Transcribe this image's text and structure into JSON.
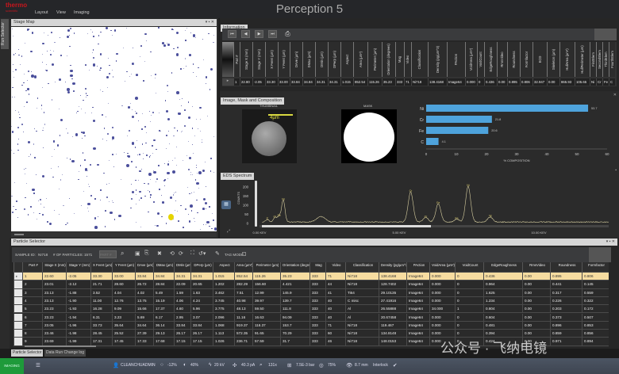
{
  "app": {
    "title": "Perception 5",
    "logo_text": "thermo scientific",
    "menu": [
      "Layout",
      "View",
      "Imaging"
    ],
    "side_tab": "Run Selector"
  },
  "stage_map": {
    "title": "Stage Map",
    "particle_color": "#4b4f9c",
    "selected_color": "#e5d400"
  },
  "information": {
    "title": "Information",
    "toolbar": [
      "first-icon",
      "prev-icon",
      "next-icon",
      "last-icon",
      "print-icon"
    ],
    "headers": [
      "Part #",
      "Stage X (mm)",
      "Stage Y (mm)",
      "X Feret (µm)",
      "Y Feret (µm)",
      "DAve (µm)",
      "DMax (µm)",
      "DMin (µm)",
      "DPerp (µm)",
      "Aspect",
      "Area (µm²)",
      "Perimeter (µm)",
      "Orientation (degrees)",
      "Mag",
      "Video",
      "Classification",
      "Density (pg/µm^3)",
      "PAction",
      "VoidArea (µm²)",
      "VoidCount",
      "EdgeRoughness",
      "RmsVideo",
      "Roundness",
      "Formfactor",
      "ECD",
      "Skeleton (µm)",
      "HullArea (µm²)",
      "HullPerimeter (µm)",
      "FirstElem",
      "SecondElem",
      "ThirdElem",
      "FourthElem"
    ],
    "values": [
      "1",
      "22.80",
      "-2.05",
      "33.30",
      "33.00",
      "33.84",
      "34.84",
      "34.31",
      "34.31",
      "1.015",
      "852.54",
      "115.26",
      "35.23",
      "333",
      "71",
      "Ni718",
      "138.4168",
      "Image64",
      "0.000",
      "0",
      "0.436",
      "0.00",
      "0.895",
      "0.806",
      "32.947",
      "0.00",
      "865.93",
      "105.65",
      "Ni",
      "Cr",
      "Fe",
      "C"
    ]
  },
  "image_mask": {
    "title": "Image, Mask and Composition",
    "thumbnail_label": "THUMBNAIL",
    "mask_label": "MASK",
    "scale_bar": "4µm"
  },
  "eds": {
    "title": "EDS Spectrum"
  },
  "chart_data": [
    {
      "type": "bar",
      "orientation": "horizontal",
      "categories": [
        "Ni",
        "Cr",
        "Fe",
        "C"
      ],
      "values": [
        53.7,
        21.8,
        20.6,
        4.1
      ],
      "data_labels": [
        "53.7",
        "21.8",
        "20.6",
        "4.1"
      ],
      "xlabel": "% COMPOSITION",
      "xlim": [
        0,
        60
      ],
      "xticks": [
        "0",
        "10",
        "20",
        "30",
        "40",
        "50",
        "60"
      ],
      "color": "#4ea3dc"
    },
    {
      "type": "line",
      "ylabel": "COUNTS",
      "ylim": [
        0,
        220
      ],
      "yticks": [
        "0",
        "50",
        "100",
        "150",
        "200"
      ],
      "xlim": [
        0,
        12.5
      ],
      "xticks": [
        {
          "v": 0,
          "label": "0.00 KEV"
        },
        {
          "v": 5,
          "label": "5.00 KEV"
        },
        {
          "v": 10,
          "label": "10.00 KEV"
        }
      ],
      "baseline": 8,
      "color": "#d8cfa0",
      "peaks": [
        {
          "x": 0.28,
          "y": 15,
          "label": "C"
        },
        {
          "x": 0.55,
          "y": 25,
          "label": "Cr"
        },
        {
          "x": 0.7,
          "y": 30,
          "label": "Fe"
        },
        {
          "x": 0.85,
          "y": 120,
          "label": "Ni"
        },
        {
          "x": 2.2,
          "y": 30,
          "label": ""
        },
        {
          "x": 5.41,
          "y": 165,
          "label": "Cr"
        },
        {
          "x": 5.95,
          "y": 25,
          "label": "Cr"
        },
        {
          "x": 6.4,
          "y": 100,
          "label": "Fe"
        },
        {
          "x": 7.06,
          "y": 15,
          "label": "Fe"
        },
        {
          "x": 7.47,
          "y": 195,
          "label": "Ni"
        },
        {
          "x": 8.26,
          "y": 28,
          "label": "Ni"
        }
      ]
    }
  ],
  "particle_selector": {
    "title": "Particle Selector",
    "sample_id_label": "SAMPLE ID:",
    "sample_id": "NI718",
    "particles_label": "# OF PARTICLES:",
    "particles": "1571",
    "part_placeholder": "PART #",
    "tag_mode_label": "TAG MODE:",
    "columns": [
      "Part #",
      "Stage X (mm)",
      "Stage Y (mm)",
      "X Feret (µm)",
      "Y Feret (µm)",
      "DAve (µm)",
      "DMax (µm)",
      "DMin (µm)",
      "DPerp (µm)",
      "Aspect",
      "Area (µm²)",
      "Perimeter (µm)",
      "Orientation (degrees)",
      "Mag",
      "Video",
      "Classification",
      "Density (pg/µm^3)",
      "PAction",
      "VoidArea (µm²)",
      "VoidCount",
      "EdgeRoughness",
      "RmsVideo",
      "Roundness",
      "Formfactor"
    ],
    "rows": [
      [
        "1",
        "22.60",
        "-2.05",
        "33.30",
        "33.00",
        "33.84",
        "34.84",
        "34.31",
        "34.31",
        "1.015",
        "852.54",
        "115.26",
        "35.23",
        "333",
        "71",
        "Ni718",
        "138.4168",
        "Image64",
        "0.000",
        "0",
        "0.436",
        "0.00",
        "0.895",
        "0.806"
      ],
      [
        "2",
        "23.01",
        "-2.12",
        "21.71",
        "28.60",
        "26.72",
        "28.84",
        "22.09",
        "20.65",
        "1.202",
        "282.29",
        "156.60",
        "4.421",
        "333",
        "44",
        "Ni718",
        "128.7402",
        "Image64",
        "0.000",
        "0",
        "0.964",
        "0.00",
        "0.441",
        "0.145"
      ],
      [
        "3",
        "23.13",
        "-1.88",
        "3.52",
        "4.04",
        "4.02",
        "5.49",
        "1.59",
        "1.63",
        "3.462",
        "7.51",
        "12.99",
        "145.9",
        "333",
        "41",
        "Ti64",
        "29.10135",
        "Image64",
        "0.000",
        "0",
        "1.625",
        "0.00",
        "0.317",
        "0.559"
      ],
      [
        "4",
        "23.13",
        "-1.90",
        "11.00",
        "12.76",
        "13.75",
        "15.19",
        "4.06",
        "4.24",
        "3.745",
        "40.98",
        "39.97",
        "139.7",
        "333",
        "40",
        "C misc",
        "27.41916",
        "Image64",
        "0.000",
        "0",
        "1.234",
        "0.00",
        "0.226",
        "0.322"
      ],
      [
        "5",
        "23.23",
        "-1.93",
        "16.28",
        "9.09",
        "15.66",
        "17.37",
        "4.60",
        "5.96",
        "3.775",
        "48.13",
        "59.50",
        "111.8",
        "333",
        "40",
        "Al",
        "26.55888",
        "Image64",
        "34.000",
        "1",
        "0.804",
        "0.00",
        "0.203",
        "0.172"
      ],
      [
        "6",
        "23.23",
        "-1.94",
        "6.31",
        "3.23",
        "5.69",
        "6.17",
        "2.95",
        "3.07",
        "2.096",
        "11.16",
        "16.63",
        "94.09",
        "333",
        "40",
        "Al",
        "20.67458",
        "Image64",
        "0.000",
        "0",
        "0.604",
        "0.00",
        "0.373",
        "0.507"
      ],
      [
        "7",
        "23.05",
        "-1.96",
        "33.73",
        "35.64",
        "34.64",
        "36.14",
        "33.84",
        "33.84",
        "1.068",
        "919.37",
        "116.37",
        "153.7",
        "333",
        "71",
        "Ni718",
        "119.467",
        "Image64",
        "0.000",
        "0",
        "0.481",
        "0.00",
        "0.896",
        "0.853"
      ],
      [
        "8",
        "23.46",
        "-1.98",
        "28.45",
        "25.52",
        "27.39",
        "29.13",
        "26.17",
        "26.17",
        "1.113",
        "572.35",
        "91.65",
        "70.29",
        "333",
        "60",
        "Ni718",
        "134.8148",
        "Image64",
        "0.000",
        "0",
        "0.394",
        "0.00",
        "0.859",
        "0.856"
      ],
      [
        "9",
        "23.69",
        "-1.99",
        "17.31",
        "17.45",
        "17.33",
        "17.68",
        "17.15",
        "17.15",
        "1.026",
        "236.71",
        "57.59",
        "31.7",
        "333",
        "46",
        "Ni718",
        "148.0153",
        "Image64",
        "0.000",
        "0",
        "0.424",
        "0.00",
        "0.971",
        "0.894"
      ]
    ],
    "selected_row_color": "#f6dca0"
  },
  "bottom_tabs": [
    "Particle Selector",
    "Data Run Change log"
  ],
  "status": {
    "mode": "IMAGING",
    "mode_color": "#1e9a3a",
    "user": "CLEANCHUADMIN",
    "brightness": "-12%",
    "contrast": "40%",
    "voltage": "20 kV",
    "current": "40.3 pA",
    "magnification": "131x",
    "pressure": "7.5E-3 bar",
    "focus": "75%",
    "working_distance": "8.7 mm",
    "interlock": "Interlock"
  },
  "watermark": "公众号 · 飞纳电镜"
}
